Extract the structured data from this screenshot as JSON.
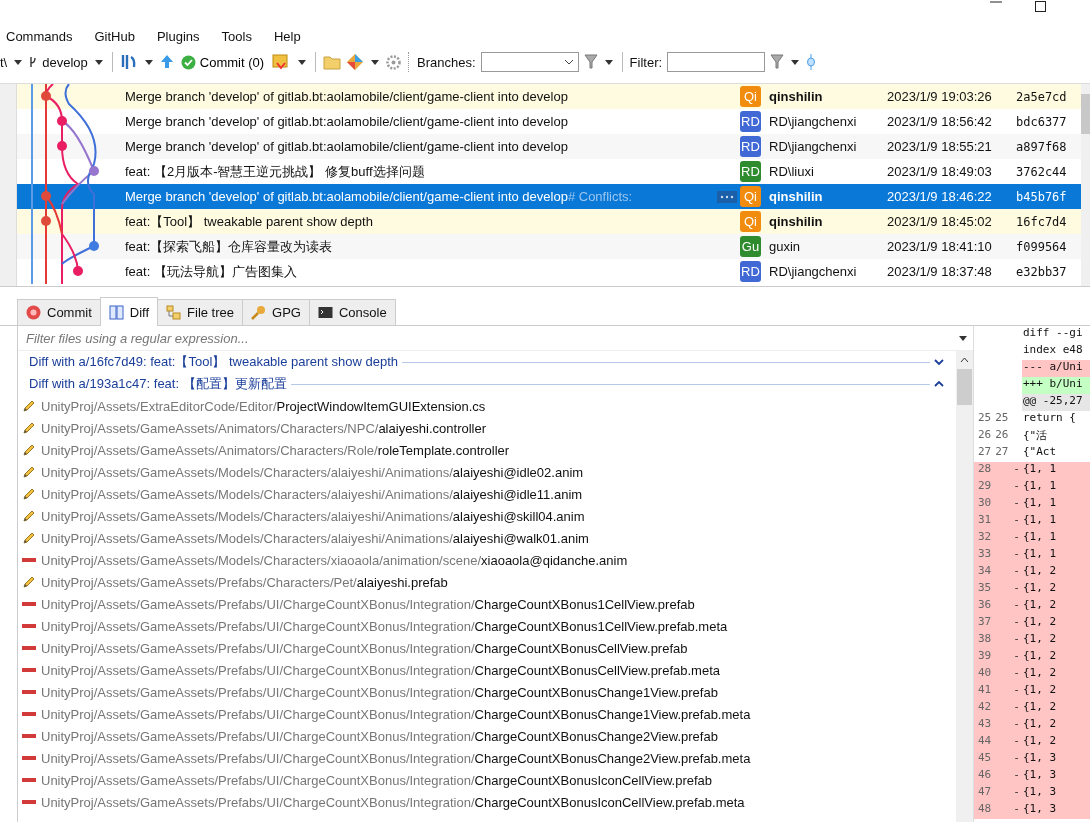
{
  "menu": [
    "Commands",
    "GitHub",
    "Plugins",
    "Tools",
    "Help"
  ],
  "toolbar": {
    "repo": "t\\",
    "branch": "develop",
    "commit": "Commit (0)",
    "branches_label": "Branches:",
    "filter_label": "Filter:"
  },
  "commits": [
    {
      "message": "Merge branch 'develop' of gitlab.bt:aolamobile/client/game-client into develop",
      "initials": "Qi",
      "color": "#f28c0f",
      "author": "qinshilin",
      "date": "2023/1/9 19:03:26",
      "hash": "2a5e7cd",
      "highlighted": true,
      "selected": false
    },
    {
      "message": "Merge branch 'develop' of gitlab.bt:aolamobile/client/game-client into develop",
      "initials": "RD",
      "color": "#4169d6",
      "author": "RD\\jiangchenxi",
      "date": "2023/1/9 18:56:42",
      "hash": "bdc6377",
      "highlighted": false,
      "selected": false
    },
    {
      "message": "Merge branch 'develop' of gitlab.bt:aolamobile/client/game-client into develop",
      "initials": "RD",
      "color": "#4169d6",
      "author": "RD\\jiangchenxi",
      "date": "2023/1/9 18:55:21",
      "hash": "a897f68",
      "highlighted": false,
      "selected": false
    },
    {
      "message": "feat: 【2月版本-智慧王逆元挑战】 修复buff选择问题",
      "initials": "RD",
      "color": "#2e8b2e",
      "author": "RD\\liuxi",
      "date": "2023/1/9 18:49:03",
      "hash": "3762c44",
      "highlighted": false,
      "selected": false
    },
    {
      "message": "Merge branch 'develop' of gitlab.bt:aolamobile/client/game-client into develop",
      "note": "# Conflicts:",
      "initials": "Qi",
      "color": "#f28c0f",
      "author": "qinshilin",
      "date": "2023/1/9 18:46:22",
      "hash": "b45b76f",
      "highlighted": true,
      "selected": true
    },
    {
      "message": "feat:【Tool】 tweakable parent show depth",
      "initials": "Qi",
      "color": "#f28c0f",
      "author": "qinshilin",
      "date": "2023/1/9 18:45:02",
      "hash": "16fc7d4",
      "highlighted": true,
      "selected": false
    },
    {
      "message": "feat:【探索飞船】仓库容量改为读表",
      "initials": "Gu",
      "color": "#2e8b2e",
      "author": "guxin",
      "date": "2023/1/9 18:41:10",
      "hash": "f099564",
      "highlighted": false,
      "selected": false
    },
    {
      "message": "feat: 【玩法导航】广告图集入",
      "initials": "RD",
      "color": "#4169d6",
      "author": "RD\\jiangchenxi",
      "date": "2023/1/9 18:37:48",
      "hash": "e32bb37",
      "highlighted": false,
      "selected": false
    }
  ],
  "tabs": [
    {
      "label": "Commit",
      "kind": "commit",
      "selected": false
    },
    {
      "label": "Diff",
      "kind": "diff",
      "selected": true
    },
    {
      "label": "File tree",
      "kind": "tree",
      "selected": false
    },
    {
      "label": "GPG",
      "kind": "gpg",
      "selected": false
    },
    {
      "label": "Console",
      "kind": "console",
      "selected": false
    }
  ],
  "file_filter": {
    "placeholder": "Filter files using a regular expression..."
  },
  "diff_groups": [
    {
      "title": "Diff with a/16fc7d49: feat:【Tool】 tweakable parent show depth",
      "expanded": false
    },
    {
      "title": "Diff with a/193a1c47: feat: 【配置】更新配置",
      "expanded": true
    }
  ],
  "files": [
    {
      "kind": "modified",
      "dir": "UnityProj/Assets/ExtraEditorCode/Editor/",
      "name": "ProjectWindowItemGUIExtension.cs"
    },
    {
      "kind": "modified",
      "dir": "UnityProj/Assets/GameAssets/Animators/Characters/NPC/",
      "name": "alaiyeshi.controller"
    },
    {
      "kind": "modified",
      "dir": "UnityProj/Assets/GameAssets/Animators/Characters/Role/",
      "name": "roleTemplate.controller"
    },
    {
      "kind": "modified",
      "dir": "UnityProj/Assets/GameAssets/Models/Characters/alaiyeshi/Animations/",
      "name": "alaiyeshi@idle02.anim"
    },
    {
      "kind": "modified",
      "dir": "UnityProj/Assets/GameAssets/Models/Characters/alaiyeshi/Animations/",
      "name": "alaiyeshi@idle11.anim"
    },
    {
      "kind": "modified",
      "dir": "UnityProj/Assets/GameAssets/Models/Characters/alaiyeshi/Animations/",
      "name": "alaiyeshi@skill04.anim"
    },
    {
      "kind": "modified",
      "dir": "UnityProj/Assets/GameAssets/Models/Characters/alaiyeshi/Animations/",
      "name": "alaiyeshi@walk01.anim"
    },
    {
      "kind": "deleted",
      "dir": "UnityProj/Assets/GameAssets/Models/Characters/xiaoaola/animation/scene/",
      "name": "xiaoaola@qidanche.anim"
    },
    {
      "kind": "modified",
      "dir": "UnityProj/Assets/GameAssets/Prefabs/Characters/Pet/",
      "name": "alaiyeshi.prefab"
    },
    {
      "kind": "deleted",
      "dir": "UnityProj/Assets/GameAssets/Prefabs/UI/ChargeCountXBonus/Integration/",
      "name": "ChargeCountXBonus1CellView.prefab"
    },
    {
      "kind": "deleted",
      "dir": "UnityProj/Assets/GameAssets/Prefabs/UI/ChargeCountXBonus/Integration/",
      "name": "ChargeCountXBonus1CellView.prefab.meta"
    },
    {
      "kind": "deleted",
      "dir": "UnityProj/Assets/GameAssets/Prefabs/UI/ChargeCountXBonus/Integration/",
      "name": "ChargeCountXBonusCellView.prefab"
    },
    {
      "kind": "deleted",
      "dir": "UnityProj/Assets/GameAssets/Prefabs/UI/ChargeCountXBonus/Integration/",
      "name": "ChargeCountXBonusCellView.prefab.meta"
    },
    {
      "kind": "deleted",
      "dir": "UnityProj/Assets/GameAssets/Prefabs/UI/ChargeCountXBonus/Integration/",
      "name": "ChargeCountXBonusChange1View.prefab"
    },
    {
      "kind": "deleted",
      "dir": "UnityProj/Assets/GameAssets/Prefabs/UI/ChargeCountXBonus/Integration/",
      "name": "ChargeCountXBonusChange1View.prefab.meta"
    },
    {
      "kind": "deleted",
      "dir": "UnityProj/Assets/GameAssets/Prefabs/UI/ChargeCountXBonus/Integration/",
      "name": "ChargeCountXBonusChange2View.prefab"
    },
    {
      "kind": "deleted",
      "dir": "UnityProj/Assets/GameAssets/Prefabs/UI/ChargeCountXBonus/Integration/",
      "name": "ChargeCountXBonusChange2View.prefab.meta"
    },
    {
      "kind": "deleted",
      "dir": "UnityProj/Assets/GameAssets/Prefabs/UI/ChargeCountXBonus/Integration/",
      "name": "ChargeCountXBonusIconCellView.prefab"
    },
    {
      "kind": "deleted",
      "dir": "UnityProj/Assets/GameAssets/Prefabs/UI/ChargeCountXBonus/Integration/",
      "name": "ChargeCountXBonusIconCellView.prefab.meta"
    }
  ],
  "diff_lines": [
    {
      "kind": "header",
      "text": "diff --gi"
    },
    {
      "kind": "header",
      "text": "index e48"
    },
    {
      "kind": "old_file",
      "text": "--- a/Uni"
    },
    {
      "kind": "new_file",
      "text": "+++ b/Uni"
    },
    {
      "kind": "hunk",
      "text": "@@ -25,27"
    },
    {
      "kind": "context",
      "old": "25",
      "new": "25",
      "text": "return {"
    },
    {
      "kind": "context",
      "old": "26",
      "new": "26",
      "text": "   {\"活"
    },
    {
      "kind": "context",
      "old": "27",
      "new": "27",
      "text": "   {\"Act"
    },
    {
      "kind": "removed",
      "old": "28",
      "sign": "-",
      "text": "{1, 1"
    },
    {
      "kind": "removed",
      "old": "29",
      "sign": "-",
      "text": "{1, 1"
    },
    {
      "kind": "removed",
      "old": "30",
      "sign": "-",
      "text": "{1, 1"
    },
    {
      "kind": "removed",
      "old": "31",
      "sign": "-",
      "text": "{1, 1"
    },
    {
      "kind": "removed",
      "old": "32",
      "sign": "-",
      "text": "{1, 1"
    },
    {
      "kind": "removed",
      "old": "33",
      "sign": "-",
      "text": "{1, 1"
    },
    {
      "kind": "removed",
      "old": "34",
      "sign": "-",
      "text": "{1, 2"
    },
    {
      "kind": "removed",
      "old": "35",
      "sign": "-",
      "text": "{1, 2"
    },
    {
      "kind": "removed",
      "old": "36",
      "sign": "-",
      "text": "{1, 2"
    },
    {
      "kind": "removed",
      "old": "37",
      "sign": "-",
      "text": "{1, 2"
    },
    {
      "kind": "removed",
      "old": "38",
      "sign": "-",
      "text": "{1, 2"
    },
    {
      "kind": "removed",
      "old": "39",
      "sign": "-",
      "text": "{1, 2"
    },
    {
      "kind": "removed",
      "old": "40",
      "sign": "-",
      "text": "{1, 2"
    },
    {
      "kind": "removed",
      "old": "41",
      "sign": "-",
      "text": "{1, 2"
    },
    {
      "kind": "removed",
      "old": "42",
      "sign": "-",
      "text": "{1, 2"
    },
    {
      "kind": "removed",
      "old": "43",
      "sign": "-",
      "text": "{1, 2"
    },
    {
      "kind": "removed",
      "old": "44",
      "sign": "-",
      "text": "{1, 2"
    },
    {
      "kind": "removed",
      "old": "45",
      "sign": "-",
      "text": "{1, 3"
    },
    {
      "kind": "removed",
      "old": "46",
      "sign": "-",
      "text": "{1, 3"
    },
    {
      "kind": "removed",
      "old": "47",
      "sign": "-",
      "text": "{1, 3"
    },
    {
      "kind": "removed",
      "old": "48",
      "sign": "-",
      "text": "{1, 3"
    }
  ]
}
